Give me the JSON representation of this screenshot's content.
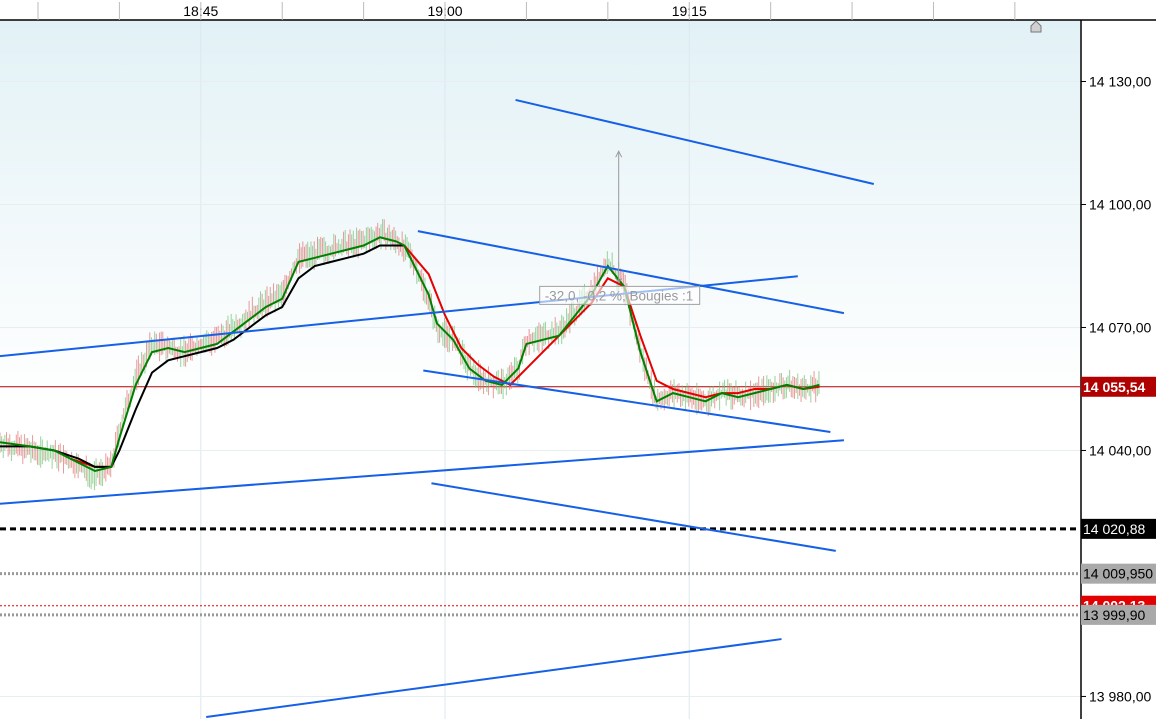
{
  "colors": {
    "bg_top": "#e2f1f6",
    "bg_bottom": "#ffffff",
    "trendline": "#1560e6",
    "ma_fast": "#008000",
    "ma_slow": "#000000",
    "ma_red": "#e60000",
    "last_price": "#b00000",
    "badge_red": "#e30000",
    "badge_black": "#000000",
    "badge_gray": "#a9a9a9",
    "candle_up": "#70c070",
    "candle_down": "#e07070"
  },
  "chart_data": {
    "type": "line",
    "title": "",
    "xlabel": "",
    "ylabel": "",
    "x_axis": {
      "type": "time",
      "ticks": [
        {
          "t": "18:45",
          "label": "18:45"
        },
        {
          "t": "19:00",
          "label": "19:00"
        },
        {
          "t": "19:15",
          "label": "19:15"
        }
      ],
      "range": [
        "18:32:40",
        "19:39:00"
      ]
    },
    "y_axis": {
      "range": [
        13974.5,
        14145.0
      ],
      "ticks": [
        14130.0,
        14100.0,
        14070.0,
        14040.0,
        13980.0
      ],
      "tick_labels": [
        "14 130,00",
        "14 100,00",
        "14 070,00",
        "14 040,00",
        "13 980,00"
      ]
    },
    "series": [
      {
        "role": "price_close",
        "x": [
          "18:32:40",
          "18:34:30",
          "18:36:00",
          "18:37:30",
          "18:38:30",
          "18:39:30",
          "18:40:00",
          "18:41:00",
          "18:42:00",
          "18:43:00",
          "18:44:00",
          "18:45:00",
          "18:46:00",
          "18:47:00",
          "18:48:00",
          "18:49:00",
          "18:50:00",
          "18:51:00",
          "18:52:00",
          "18:53:00",
          "18:54:00",
          "18:55:00",
          "18:56:00",
          "18:57:00",
          "18:58:00",
          "18:59:00",
          "18:59:30",
          "19:00:30",
          "19:01:30",
          "19:02:30",
          "19:03:30",
          "19:04:30",
          "19:05:00",
          "19:06:00",
          "19:07:00",
          "19:08:00",
          "19:09:00",
          "19:10:00",
          "19:11:00",
          "19:12:00",
          "19:13:00",
          "19:14:00",
          "19:15:00",
          "19:16:00",
          "19:17:00",
          "19:18:00",
          "19:19:00",
          "19:20:00",
          "19:21:00",
          "19:22:00",
          "19:23:00"
        ],
        "values": [
          14042,
          14040,
          14039,
          14036,
          14034,
          14036,
          14045,
          14058,
          14066,
          14065,
          14064,
          14066,
          14067,
          14070,
          14073,
          14076,
          14078,
          14087,
          14088,
          14089,
          14090,
          14091,
          14093,
          14091,
          14087,
          14077,
          14070,
          14067,
          14060,
          14057,
          14056,
          14060,
          14067,
          14068,
          14069,
          14074,
          14079,
          14086,
          14080,
          14064,
          14052,
          14054,
          14053,
          14052,
          14054,
          14053,
          14054,
          14055,
          14056,
          14055,
          14055.54
        ]
      },
      {
        "name": "",
        "role": "ma_fast",
        "x": [
          "18:32:40",
          "18:34:30",
          "18:36:00",
          "18:37:30",
          "18:38:30",
          "18:39:30",
          "18:40:00",
          "18:41:00",
          "18:42:00",
          "18:43:00",
          "18:44:00",
          "18:45:00",
          "18:46:00",
          "18:47:00",
          "18:48:00",
          "18:49:00",
          "18:50:00",
          "18:51:00",
          "18:52:00",
          "18:53:00",
          "18:54:00",
          "18:55:00",
          "18:56:00",
          "18:57:00",
          "18:57:30",
          "18:59:00",
          "18:59:30",
          "19:00:30",
          "19:01:30",
          "19:02:30",
          "19:03:30",
          "19:04:30",
          "19:05:00",
          "19:06:00",
          "19:07:00",
          "19:08:00",
          "19:09:00",
          "19:10:00",
          "19:11:00",
          "19:12:00",
          "19:13:00",
          "19:14:00",
          "19:15:00",
          "19:16:00",
          "19:17:00",
          "19:18:00",
          "19:19:00",
          "19:20:00",
          "19:21:00",
          "19:22:00",
          "19:23:00"
        ],
        "values": [
          14042,
          14041,
          14040,
          14037,
          14035,
          14036,
          14043,
          14056,
          14064,
          14065,
          14064,
          14065,
          14066,
          14069,
          14072,
          14075,
          14077,
          14086,
          14087,
          14088,
          14089,
          14090,
          14092,
          14091,
          14090,
          14078,
          14071,
          14067,
          14060,
          14057,
          14056,
          14060,
          14066,
          14067,
          14068,
          14073,
          14078,
          14085,
          14080,
          14064,
          14052,
          14054,
          14053,
          14052,
          14054,
          14053,
          14054,
          14055,
          14056,
          14055,
          14056
        ]
      },
      {
        "name": "",
        "role": "ma_slow",
        "x": [
          "18:32:40",
          "18:34:30",
          "18:36:00",
          "18:37:30",
          "18:38:30",
          "18:39:30",
          "18:40:00",
          "18:41:00",
          "18:42:00",
          "18:43:00",
          "18:44:00",
          "18:45:00",
          "18:46:00",
          "18:47:00",
          "18:48:00",
          "18:49:00",
          "18:50:00",
          "18:51:00",
          "18:52:00",
          "18:53:00",
          "18:54:00",
          "18:55:00",
          "18:56:00",
          "18:57:00",
          "18:57:30"
        ],
        "values": [
          14041,
          14041,
          14040,
          14038,
          14036,
          14036,
          14040,
          14050,
          14059,
          14062,
          14063,
          14064,
          14065,
          14067,
          14070,
          14073,
          14075,
          14082,
          14085,
          14086,
          14087,
          14088,
          14090,
          14090,
          14090
        ]
      },
      {
        "name": "",
        "role": "ma_red",
        "x": [
          "18:37:00",
          "18:38:30",
          "18:39:30",
          "18:57:30",
          "18:59:00",
          "19:00:00",
          "19:01:00",
          "19:02:00",
          "19:03:00",
          "19:04:00",
          "19:09:00",
          "19:10:00",
          "19:11:00",
          "19:12:00",
          "19:13:00",
          "19:14:00",
          "19:15:00",
          "19:16:00",
          "19:17:00",
          "19:18:00",
          "19:19:00",
          "19:20:00",
          "19:21:00",
          "19:22:00",
          "19:23:00"
        ],
        "values": [
          14038,
          14036,
          14036,
          14090,
          14083,
          14073,
          14065,
          14061,
          14058,
          14056,
          14076,
          14082,
          14080,
          14068,
          14057,
          14055,
          14054,
          14053,
          14054,
          14054,
          14055,
          14055,
          14056,
          14055,
          14055.54
        ]
      }
    ],
    "trendlines": [
      {
        "from": [
          "19:04:20",
          14125.5
        ],
        "to": [
          "19:26:20",
          14105.0
        ]
      },
      {
        "from": [
          "18:32:40",
          14063.0
        ],
        "to": [
          "19:21:40",
          14082.5
        ]
      },
      {
        "from": [
          "18:58:20",
          14093.5
        ],
        "to": [
          "19:24:30",
          14073.5
        ]
      },
      {
        "from": [
          "18:58:40",
          14059.5
        ],
        "to": [
          "19:23:40",
          14044.5
        ]
      },
      {
        "from": [
          "18:32:40",
          14027.0
        ],
        "to": [
          "19:24:30",
          14042.5
        ]
      },
      {
        "from": [
          "18:59:10",
          14032.0
        ],
        "to": [
          "19:24:00",
          14015.5
        ]
      },
      {
        "from": [
          "18:45:20",
          13975.0
        ],
        "to": [
          "19:20:40",
          13994.0
        ]
      }
    ],
    "measure": {
      "x": "19:10:40",
      "from": 14081.0,
      "to": 14113.0,
      "label": "-32,0, -0,2 %, Bougies :1"
    },
    "horizontal_levels": [
      {
        "value": 14055.54,
        "label": "14 055,54",
        "style": "last-price"
      },
      {
        "value": 14020.88,
        "label": "14 020,88",
        "style": "dashed"
      },
      {
        "value": 14009.95,
        "label": "14 009,950",
        "style": "dotted"
      },
      {
        "value": 14002.13,
        "label": "14 002,13",
        "style": "red-dotted"
      },
      {
        "value": 13999.9,
        "label": "13 999,90",
        "style": "dotted"
      }
    ],
    "grid": true,
    "legend": "none"
  }
}
